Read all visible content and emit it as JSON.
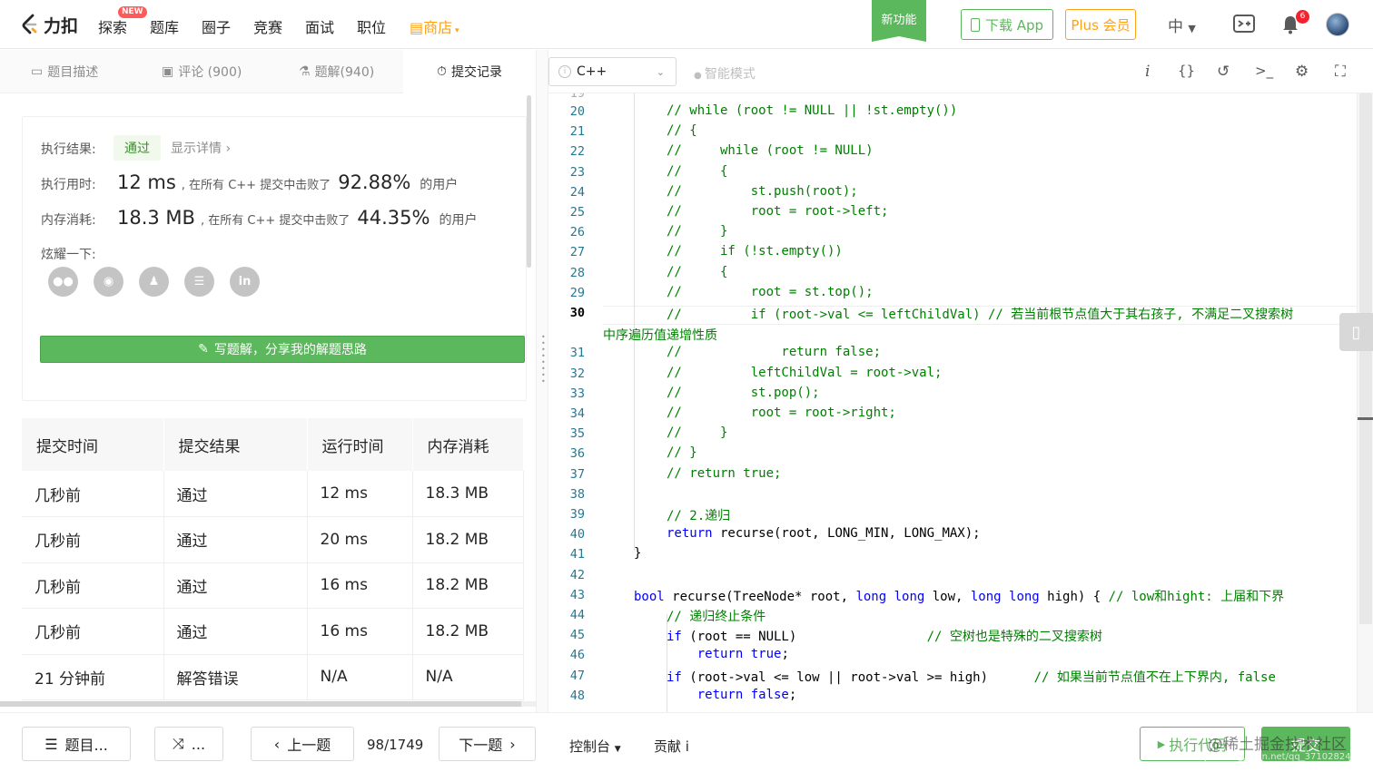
{
  "nav": {
    "logo_text": "力扣",
    "items": [
      "探索",
      "题库",
      "圈子",
      "竞赛",
      "面试",
      "职位"
    ],
    "store": "商店",
    "new_badge": "NEW",
    "new_feature": "新功能",
    "download_app": "下载 App",
    "plus": "Plus 会员",
    "lang": "中",
    "notif_count": "6"
  },
  "tabs": [
    {
      "label": "题目描述",
      "icon": "doc-icon"
    },
    {
      "label": "评论 (900)",
      "icon": "comment-icon"
    },
    {
      "label": "题解(940)",
      "icon": "flask-icon"
    },
    {
      "label": "提交记录",
      "icon": "clock-icon"
    }
  ],
  "result": {
    "exec_label": "执行结果:",
    "status": "通过",
    "detail": "显示详情",
    "time_label": "执行用时:",
    "time_value": "12 ms",
    "time_mid": ", 在所有 C++ 提交中击败了",
    "time_pct": "92.88%",
    "suffix": "的用户",
    "mem_label": "内存消耗:",
    "mem_value": "18.3 MB",
    "mem_mid": ", 在所有 C++ 提交中击败了",
    "mem_pct": "44.35%",
    "share_label": "炫耀一下:",
    "share_icons": [
      "wechat-icon",
      "weibo-icon",
      "qq-icon",
      "douban-icon",
      "linkedin-icon"
    ],
    "write_btn": "写题解，分享我的解题思路"
  },
  "table": {
    "headers": [
      "提交时间",
      "提交结果",
      "运行时间",
      "内存消耗"
    ],
    "rows": [
      {
        "time": "几秒前",
        "result": "通过",
        "runtime": "12 ms",
        "memory": "18.3 MB"
      },
      {
        "time": "几秒前",
        "result": "通过",
        "runtime": "20 ms",
        "memory": "18.2 MB"
      },
      {
        "time": "几秒前",
        "result": "通过",
        "runtime": "16 ms",
        "memory": "18.2 MB"
      },
      {
        "time": "几秒前",
        "result": "通过",
        "runtime": "16 ms",
        "memory": "18.2 MB"
      },
      {
        "time": "21 分钟前",
        "result": "解答错误",
        "runtime": "N/A",
        "memory": "N/A"
      }
    ]
  },
  "editor": {
    "language": "C++",
    "smart_mode": "智能模式",
    "current_line": "30",
    "wrap_text": "中序遍历值递增性质",
    "lines": [
      {
        "n": "20",
        "segs": [
          {
            "t": "// while (root != NULL || !st.empty())",
            "c": "cmt"
          }
        ],
        "in": 1
      },
      {
        "n": "21",
        "segs": [
          {
            "t": "// {",
            "c": "cmt"
          }
        ],
        "in": 1
      },
      {
        "n": "22",
        "segs": [
          {
            "t": "//     while (root != NULL)",
            "c": "cmt"
          }
        ],
        "in": 1
      },
      {
        "n": "23",
        "segs": [
          {
            "t": "//     {",
            "c": "cmt"
          }
        ],
        "in": 1
      },
      {
        "n": "24",
        "segs": [
          {
            "t": "//         st.push(root);",
            "c": "cmt"
          }
        ],
        "in": 1
      },
      {
        "n": "25",
        "segs": [
          {
            "t": "//         root = root->left;",
            "c": "cmt"
          }
        ],
        "in": 1
      },
      {
        "n": "26",
        "segs": [
          {
            "t": "//     }",
            "c": "cmt"
          }
        ],
        "in": 1
      },
      {
        "n": "27",
        "segs": [
          {
            "t": "//     if (!st.empty())",
            "c": "cmt"
          }
        ],
        "in": 1
      },
      {
        "n": "28",
        "segs": [
          {
            "t": "//     {",
            "c": "cmt"
          }
        ],
        "in": 1
      },
      {
        "n": "29",
        "segs": [
          {
            "t": "//         root = st.top();",
            "c": "cmt"
          }
        ],
        "in": 1
      },
      {
        "n": "30",
        "segs": [
          {
            "t": "//         if (root->val <= leftChildVal) // 若当前根节点值大于其右孩子, 不满足二叉搜索树",
            "c": "cmt"
          }
        ],
        "in": 1
      },
      {
        "n": "31",
        "segs": [
          {
            "t": "//             return false;",
            "c": "cmt"
          }
        ],
        "in": 1
      },
      {
        "n": "32",
        "segs": [
          {
            "t": "//         leftChildVal = root->val;",
            "c": "cmt"
          }
        ],
        "in": 1
      },
      {
        "n": "33",
        "segs": [
          {
            "t": "//         st.pop();",
            "c": "cmt"
          }
        ],
        "in": 1
      },
      {
        "n": "34",
        "segs": [
          {
            "t": "//         root = root->right;",
            "c": "cmt"
          }
        ],
        "in": 1
      },
      {
        "n": "35",
        "segs": [
          {
            "t": "//     }",
            "c": "cmt"
          }
        ],
        "in": 1
      },
      {
        "n": "36",
        "segs": [
          {
            "t": "// }",
            "c": "cmt"
          }
        ],
        "in": 1
      },
      {
        "n": "37",
        "segs": [
          {
            "t": "// return true;",
            "c": "cmt"
          }
        ],
        "in": 1
      },
      {
        "n": "38",
        "segs": [],
        "in": 1
      },
      {
        "n": "39",
        "segs": [
          {
            "t": "// 2.递归",
            "c": "cmt"
          }
        ],
        "in": 1
      },
      {
        "n": "40",
        "segs": [
          {
            "t": "return",
            "c": "kw"
          },
          {
            "t": " recurse(root, LONG_MIN, LONG_MAX);",
            "c": ""
          }
        ],
        "in": 1
      },
      {
        "n": "41",
        "segs": [
          {
            "t": "}",
            "c": ""
          }
        ],
        "in": 0
      },
      {
        "n": "42",
        "segs": [],
        "in": 0
      },
      {
        "n": "43",
        "segs": [
          {
            "t": "bool",
            "c": "kw"
          },
          {
            "t": " recurse(TreeNode* root, ",
            "c": ""
          },
          {
            "t": "long long",
            "c": "kw"
          },
          {
            "t": " low, ",
            "c": ""
          },
          {
            "t": "long long",
            "c": "kw"
          },
          {
            "t": " high) { ",
            "c": ""
          },
          {
            "t": "// low和hight: 上届和下界",
            "c": "cmt"
          }
        ],
        "in": 0
      },
      {
        "n": "44",
        "segs": [
          {
            "t": "// 递归终止条件",
            "c": "cmt"
          }
        ],
        "in": 1
      },
      {
        "n": "45",
        "segs": [
          {
            "t": "if",
            "c": "kw"
          },
          {
            "t": " (root == NULL)                 ",
            "c": ""
          },
          {
            "t": "// 空树也是特殊的二叉搜索树",
            "c": "cmt"
          }
        ],
        "in": 1
      },
      {
        "n": "46",
        "segs": [
          {
            "t": "    ",
            "c": ""
          },
          {
            "t": "return true",
            "c": "kw"
          },
          {
            "t": ";",
            "c": ""
          }
        ],
        "in": 1
      },
      {
        "n": "47",
        "segs": [
          {
            "t": "if",
            "c": "kw"
          },
          {
            "t": " (root->val <= low || root->val >= high)      ",
            "c": ""
          },
          {
            "t": "// 如果当前节点值不在上下界内, false",
            "c": "cmt"
          }
        ],
        "in": 1
      },
      {
        "n": "48",
        "segs": [
          {
            "t": "    ",
            "c": ""
          },
          {
            "t": "return false",
            "c": "kw"
          },
          {
            "t": ";",
            "c": ""
          }
        ],
        "in": 1
      }
    ]
  },
  "bottom": {
    "list_btn": "题目...",
    "random_btn": "...",
    "prev": "上一题",
    "page": "98/1749",
    "next": "下一题",
    "console": "控制台",
    "contribute": "贡献 i",
    "run": "执行代码",
    "submit": "提交",
    "watermark": "@稀土掘金技术社区",
    "watermark_url": "https://blog.csdn.net/qq_37102824"
  }
}
